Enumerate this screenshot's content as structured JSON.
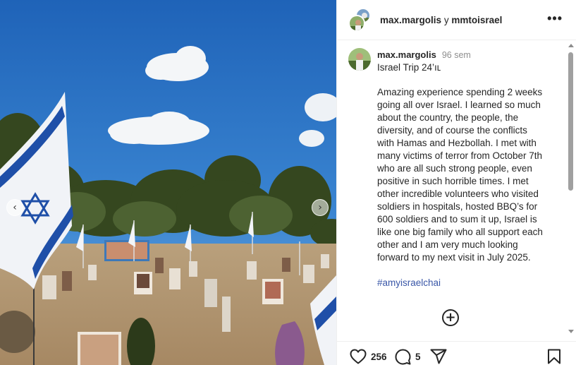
{
  "post": {
    "header": {
      "user": "max.margolis",
      "conjunction": "y",
      "collaborator": "mmtoisrael"
    },
    "caption": {
      "user": "max.margolis",
      "time": "96 sem",
      "title": "Israel Trip 24’ıʟ",
      "body_lines": [
        "Amazing experience spending 2 weeks",
        "going all over Israel. I learned so much",
        "about the country, the people, the",
        "diversity, and of course the conflicts",
        "with Hamas and Hezbollah. I met with",
        "many victims of terror from October 7th",
        "who are all such strong people, even",
        "positive in such horrible times. I met",
        "other incredible volunteers who visited",
        "soldiers in hospitals, hosted BBQ’s for",
        "600 soldiers and to sum it up, Israel is",
        "like one big family who all support each",
        "other and I am very much looking",
        "forward to my next visit in July 2025."
      ],
      "hashtag": "#amyisraelchai"
    },
    "actions": {
      "likes": "256",
      "comments": "5"
    },
    "icons": {
      "more": "more-options-icon",
      "load_more": "plus-circle-icon",
      "like": "heart-icon",
      "comment": "comment-bubble-icon",
      "share": "paper-plane-icon",
      "save": "bookmark-icon",
      "prev": "chevron-left-icon",
      "next": "chevron-right-icon"
    },
    "colors": {
      "hashtag": "#3a57a8",
      "sky": "#2f78c8",
      "flag_blue": "#1f4fa8"
    }
  }
}
